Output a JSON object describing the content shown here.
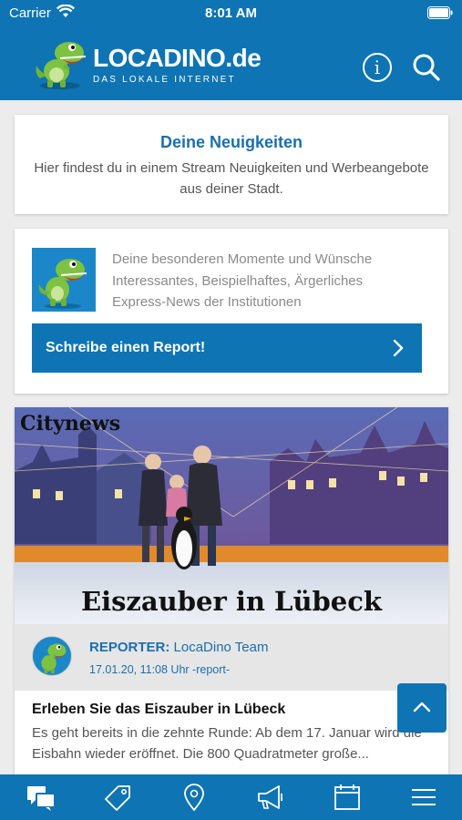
{
  "status_bar": {
    "carrier": "Carrier",
    "time": "8:01 AM"
  },
  "header": {
    "logo_text": "LOCADINO.de",
    "logo_tagline": "DAS LOKALE INTERNET",
    "info_label": "i"
  },
  "news_intro": {
    "title": "Deine Neuigkeiten",
    "text": "Hier findest du in einem Stream Neuigkeiten und Werbeangebote aus deiner Stadt."
  },
  "report_prompt": {
    "lines": [
      "Deine besonderen Momente und Wünsche",
      "Interessantes, Beispielhaftes, Ärgerliches",
      "Express-News der Institutionen"
    ],
    "button_label": "Schreibe einen Report!"
  },
  "post": {
    "image_badge": "Citynews",
    "image_title": "Eiszauber in Lübeck",
    "reporter_prefix": "REPORTER:",
    "reporter_name": "LocaDino Team",
    "date": "17.01.20, 11:08 Uhr -report-",
    "title": "Erleben Sie das Eiszauber in Lübeck",
    "text": "Es geht bereits in die zehnte Runde: Ab dem 17. Januar wird die Eisbahn wieder eröffnet. Die 800 Quadratmeter große..."
  },
  "tab_bar": {
    "tabs": [
      {
        "icon": "chat-bubbles-icon"
      },
      {
        "icon": "tag-icon"
      },
      {
        "icon": "location-pin-icon"
      },
      {
        "icon": "megaphone-icon"
      },
      {
        "icon": "calendar-icon"
      },
      {
        "icon": "menu-icon"
      }
    ]
  },
  "colors": {
    "brand_blue": "#0e74b3",
    "accent_text": "#1a6fae",
    "dino_green": "#7ec242"
  }
}
